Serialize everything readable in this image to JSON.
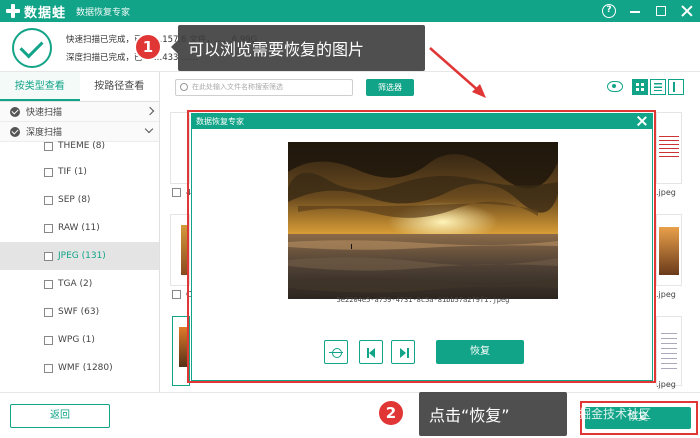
{
  "app": {
    "logo_text": "数据蛙",
    "subtitle": "数据恢复专家"
  },
  "window_controls": {
    "help": "?"
  },
  "status": {
    "line1": "快速扫描已完成，已 ……157.6 文件，……6.99G",
    "line2": "深度扫描已完成，已 ……433 ……"
  },
  "callouts": [
    {
      "step": "1",
      "text": "可以浏览需要恢复的图片"
    },
    {
      "step": "2",
      "text": "点击“恢复”"
    }
  ],
  "sidebar": {
    "tabs": [
      {
        "label": "按类型查看"
      },
      {
        "label": "按路径查看"
      }
    ],
    "scans": [
      {
        "label": "快速扫描"
      },
      {
        "label": "深度扫描"
      }
    ],
    "types": [
      {
        "label": "THEME (8)"
      },
      {
        "label": "TIF (1)"
      },
      {
        "label": "SEP (8)"
      },
      {
        "label": "RAW (11)"
      },
      {
        "label": "JPEG (131)",
        "selected": true
      },
      {
        "label": "TGA (2)"
      },
      {
        "label": "SWF (63)"
      },
      {
        "label": "WPG (1)"
      },
      {
        "label": "WMF (1280)"
      }
    ]
  },
  "toolbar": {
    "search_placeholder": "在此处输入文件名称搜索筛选",
    "filter_label": "筛选器"
  },
  "grid_labels": {
    "left_top": "4",
    "right_top": ".jpeg",
    "left_mid": "C",
    "right_mid": ".jpeg",
    "right_bottom": ".jpeg"
  },
  "dialog": {
    "title": "数据恢复专家",
    "filename": "5e2204e5-a759-4731-8c5a-81bb57a2f9f1.jpeg",
    "recover_label": "恢复"
  },
  "footer": {
    "back_label": "返回",
    "recover_label": "恢复"
  },
  "watermark": "稀土掘金技术社区",
  "colors": {
    "accent": "#12a488",
    "highlight": "#e03636"
  }
}
